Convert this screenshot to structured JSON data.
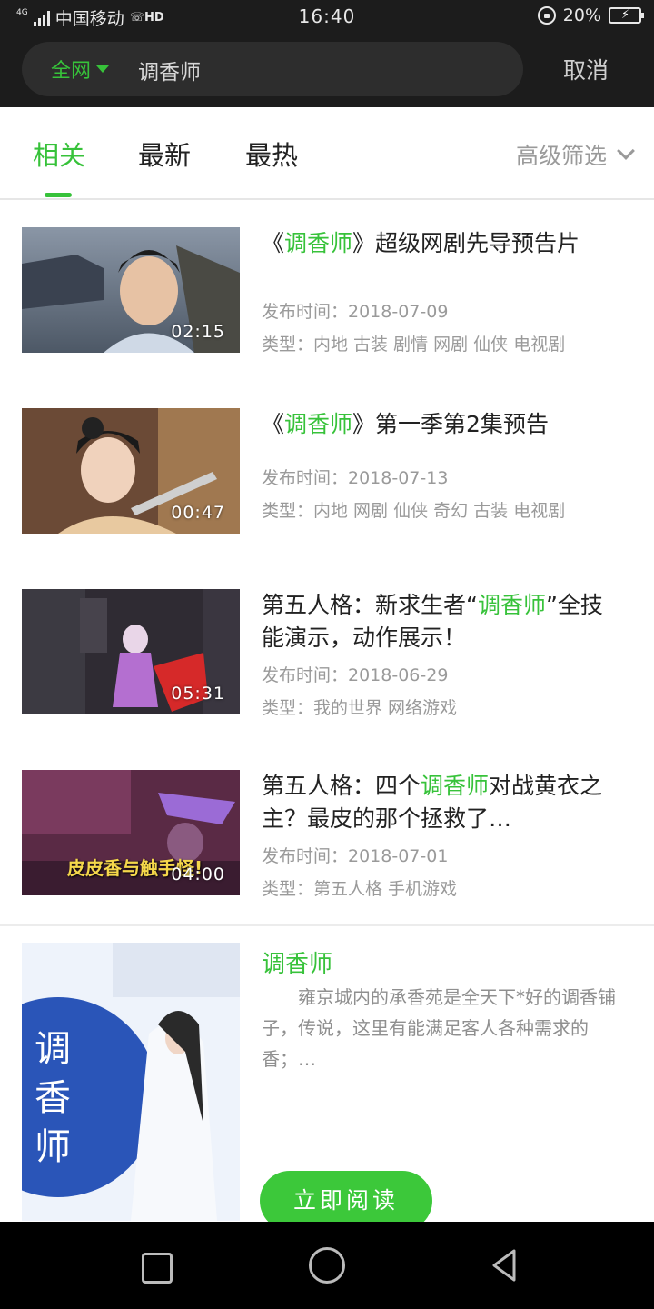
{
  "status": {
    "network_tag": "4G",
    "carrier": "中国移动",
    "hd": "HD",
    "time": "16:40",
    "battery": "20%",
    "battery_level": 0.2
  },
  "search": {
    "scope": "全网",
    "query": "调香师",
    "cancel": "取消"
  },
  "tabs": [
    {
      "label": "相关",
      "active": true
    },
    {
      "label": "最新",
      "active": false
    },
    {
      "label": "最热",
      "active": false
    }
  ],
  "filter_label": "高级筛选",
  "results": [
    {
      "title_pre": "《",
      "title_hl": "调香师",
      "title_post": "》超级网剧先导预告片",
      "date": "发布时间：2018-07-09",
      "type": "类型：内地 古装 剧情 网剧 仙侠 电视剧",
      "duration": "02:15"
    },
    {
      "title_pre": "《",
      "title_hl": "调香师",
      "title_post": "》第一季第2集预告",
      "date": "发布时间：2018-07-13",
      "type": "类型：内地 网剧 仙侠 奇幻 古装 电视剧",
      "duration": "00:47"
    },
    {
      "title_pre": "第五人格：新求生者“",
      "title_hl": "调香师",
      "title_post": "”全技能演示，动作展示！",
      "date": "发布时间：2018-06-29",
      "type": "类型：我的世界 网络游戏",
      "duration": "05:31"
    },
    {
      "title_pre": "第五人格：四个",
      "title_hl": "调香师",
      "title_post": "对战黄衣之主？最皮的那个拯救了…",
      "date": "发布时间：2018-07-01",
      "type": "类型：第五人格 手机游戏",
      "duration": "04:00",
      "caption": "皮皮香与触手怪!"
    }
  ],
  "book": {
    "title": "调香师",
    "description": "雍京城内的承香苑是全天下*好的调香铺子，传说，这里有能满足客人各种需求的香；…",
    "cover_text": "调香师",
    "read_button": "立即阅读"
  },
  "colors": {
    "accent": "#37c23a",
    "topbar": "#1c1c1c",
    "meta_text": "#9a9a9a"
  }
}
